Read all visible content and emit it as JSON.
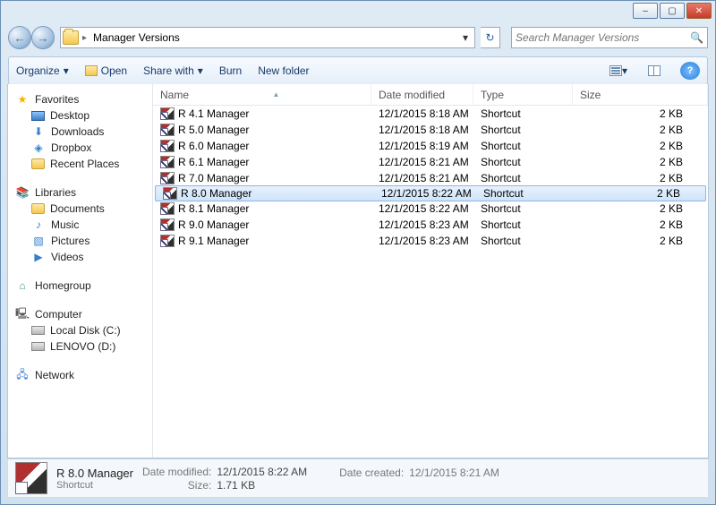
{
  "window": {
    "min_label": "–",
    "max_label": "▢",
    "close_label": "✕"
  },
  "address": {
    "crumb": "Manager Versions",
    "dropdown_glyph": "▾",
    "refresh_glyph": "↻",
    "back_glyph": "←",
    "fwd_glyph": "→",
    "sep_glyph": "▸"
  },
  "search": {
    "placeholder": "Search Manager Versions",
    "icon": "🔍"
  },
  "toolbar": {
    "organize": "Organize",
    "organize_arrow": "▾",
    "open": "Open",
    "sharewith": "Share with",
    "sharewith_arrow": "▾",
    "burn": "Burn",
    "newfolder": "New folder",
    "view_arrow": "▾",
    "help_glyph": "?"
  },
  "columns": {
    "name": "Name",
    "date": "Date modified",
    "type": "Type",
    "size": "Size",
    "sort_arrow": "▲"
  },
  "nav": {
    "favorites": "Favorites",
    "desktop": "Desktop",
    "downloads": "Downloads",
    "dropbox": "Dropbox",
    "recent": "Recent Places",
    "libraries": "Libraries",
    "documents": "Documents",
    "music": "Music",
    "pictures": "Pictures",
    "videos": "Videos",
    "homegroup": "Homegroup",
    "computer": "Computer",
    "cdrive": "Local Disk (C:)",
    "ddrive": "LENOVO (D:)",
    "network": "Network"
  },
  "files": [
    {
      "name": "R 4.1 Manager",
      "date": "12/1/2015 8:18 AM",
      "type": "Shortcut",
      "size": "2 KB",
      "selected": false
    },
    {
      "name": "R 5.0 Manager",
      "date": "12/1/2015 8:18 AM",
      "type": "Shortcut",
      "size": "2 KB",
      "selected": false
    },
    {
      "name": "R 6.0 Manager",
      "date": "12/1/2015 8:19 AM",
      "type": "Shortcut",
      "size": "2 KB",
      "selected": false
    },
    {
      "name": "R 6.1 Manager",
      "date": "12/1/2015 8:21 AM",
      "type": "Shortcut",
      "size": "2 KB",
      "selected": false
    },
    {
      "name": "R 7.0 Manager",
      "date": "12/1/2015 8:21 AM",
      "type": "Shortcut",
      "size": "2 KB",
      "selected": false
    },
    {
      "name": "R 8.0 Manager",
      "date": "12/1/2015 8:22 AM",
      "type": "Shortcut",
      "size": "2 KB",
      "selected": true
    },
    {
      "name": "R 8.1 Manager",
      "date": "12/1/2015 8:22 AM",
      "type": "Shortcut",
      "size": "2 KB",
      "selected": false
    },
    {
      "name": "R 9.0 Manager",
      "date": "12/1/2015 8:23 AM",
      "type": "Shortcut",
      "size": "2 KB",
      "selected": false
    },
    {
      "name": "R 9.1 Manager",
      "date": "12/1/2015 8:23 AM",
      "type": "Shortcut",
      "size": "2 KB",
      "selected": false
    }
  ],
  "details": {
    "name": "R 8.0 Manager",
    "type": "Shortcut",
    "modified_label": "Date modified:",
    "modified_value": "12/1/2015 8:22 AM",
    "size_label": "Size:",
    "size_value": "1.71 KB",
    "created_label": "Date created:",
    "created_value": "12/1/2015 8:21 AM"
  }
}
